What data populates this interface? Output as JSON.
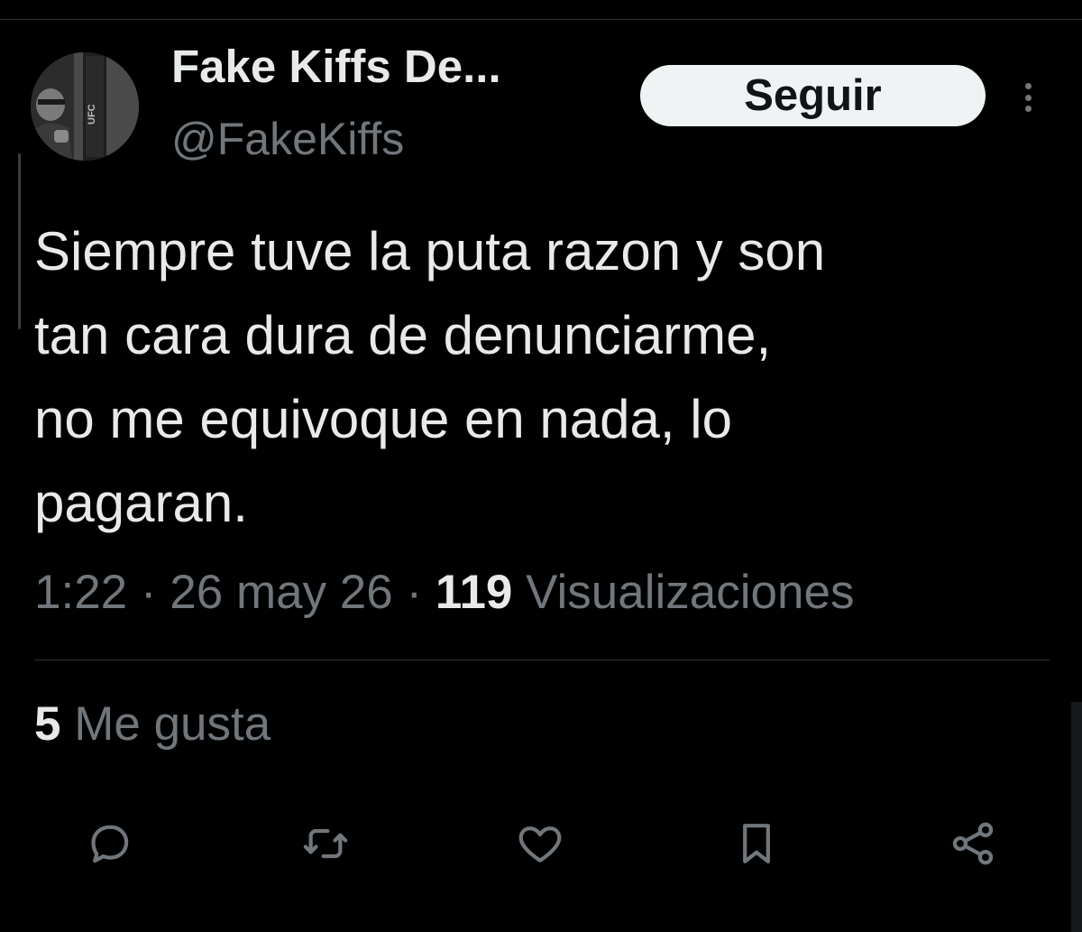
{
  "header": {
    "display_name": "Fake Kiffs De...",
    "handle": "@FakeKiffs",
    "follow_label": "Seguir",
    "more_icon": "more-vertical-icon",
    "avatar_image_text": "UFC"
  },
  "tweet": {
    "text": "Siempre tuve la puta razon y son\ntan cara dura de denunciarme,\nno me equivoque en nada, lo\npagaran.",
    "time": "1:22",
    "separator": "·",
    "date": "26 may 26",
    "views_count": "119",
    "views_label": "Visualizaciones"
  },
  "stats": {
    "likes_count": "5",
    "likes_label": "Me gusta"
  },
  "actions": [
    {
      "icon": "reply-icon"
    },
    {
      "icon": "retweet-icon"
    },
    {
      "icon": "like-heart-icon"
    },
    {
      "icon": "bookmark-icon"
    },
    {
      "icon": "share-icon"
    }
  ],
  "colors": {
    "background": "#000000",
    "primary_text": "#e7e9ea",
    "secondary_text": "#71767b",
    "follow_button_bg": "#eff3f4",
    "follow_button_text": "#0f1419",
    "divider": "#2f3336"
  }
}
